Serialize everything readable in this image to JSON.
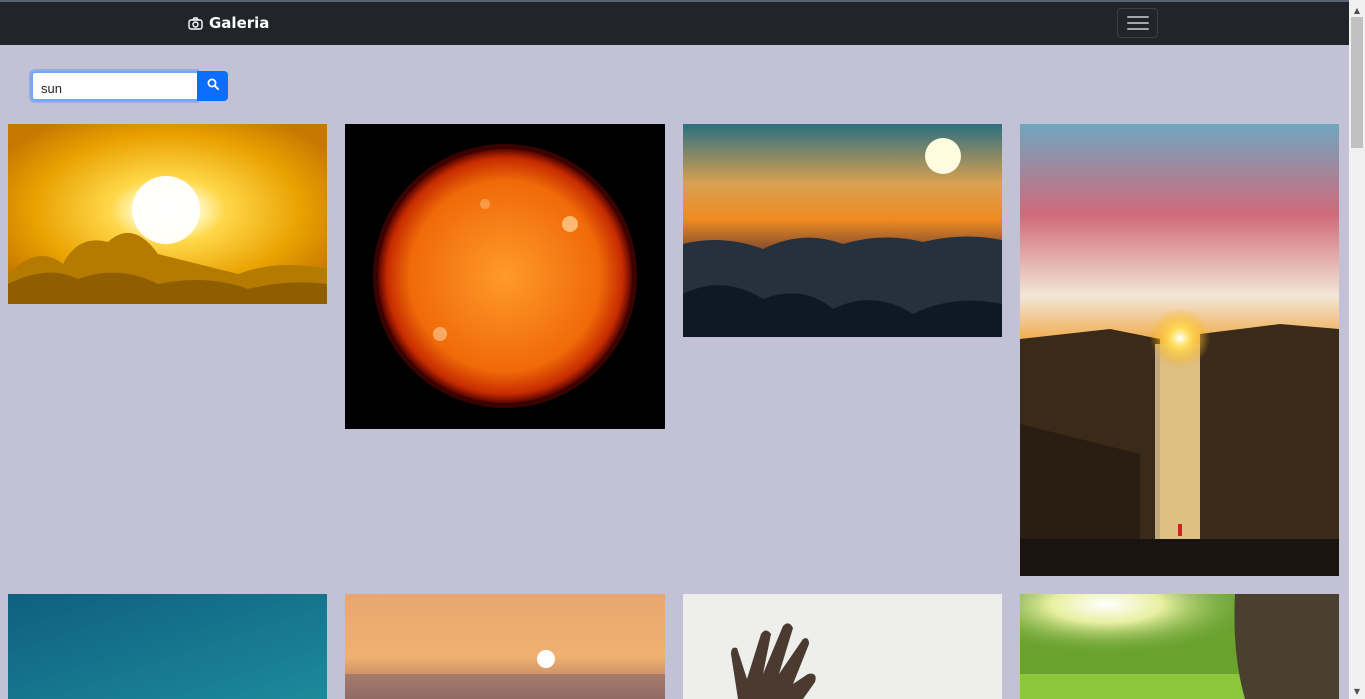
{
  "navbar": {
    "brand_label": "Galeria",
    "brand_icon": "camera-icon",
    "menu_icon": "hamburger-menu-icon"
  },
  "search": {
    "value": "sun",
    "button_icon": "search-icon"
  },
  "colors": {
    "navbar_bg": "#212529",
    "page_bg": "#c3c1d6",
    "search_button": "#0d6efd"
  },
  "gallery": {
    "images": [
      {
        "subject": "sun-behind-yellow-clouds"
      },
      {
        "subject": "solar-surface-sphere"
      },
      {
        "subject": "sunset-above-cloud-sea"
      },
      {
        "subject": "sunrise-over-waterfall-cliff"
      },
      {
        "subject": "blue-sky"
      },
      {
        "subject": "sunset-over-sea"
      },
      {
        "subject": "hand-reaching-to-light"
      },
      {
        "subject": "sunlight-through-tree-on-meadow"
      }
    ]
  }
}
